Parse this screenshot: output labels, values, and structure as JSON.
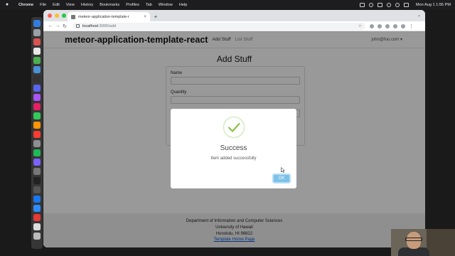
{
  "menubar": {
    "app": "Chrome",
    "items": [
      "File",
      "Edit",
      "View",
      "History",
      "Bookmarks",
      "Profiles",
      "Tab",
      "Window",
      "Help"
    ],
    "clock": "Mon Aug 1  1:55 PM"
  },
  "browser": {
    "tab_title": "meteor-application-template-r",
    "url_host": "localhost",
    "url_path": ":3000/add"
  },
  "app": {
    "brand": "meteor-application-template-react",
    "nav_add": "Add Stuff",
    "nav_list": "List Stuff",
    "user": "john@foo.com"
  },
  "form": {
    "title": "Add Stuff",
    "name_label": "Name",
    "quantity_label": "Quantity"
  },
  "modal": {
    "title": "Success",
    "message": "Item added successfully",
    "ok_label": "OK"
  },
  "footer": {
    "line1": "Department of Information and Computer Sciences",
    "line2": "University of Hawaii",
    "line3": "Honolulu, HI 96822",
    "link": "Template Home Page"
  },
  "colors": {
    "success_check": "#8bc34a",
    "ok_button": "#7cc2e8",
    "submit_button": "#0d6efd"
  }
}
